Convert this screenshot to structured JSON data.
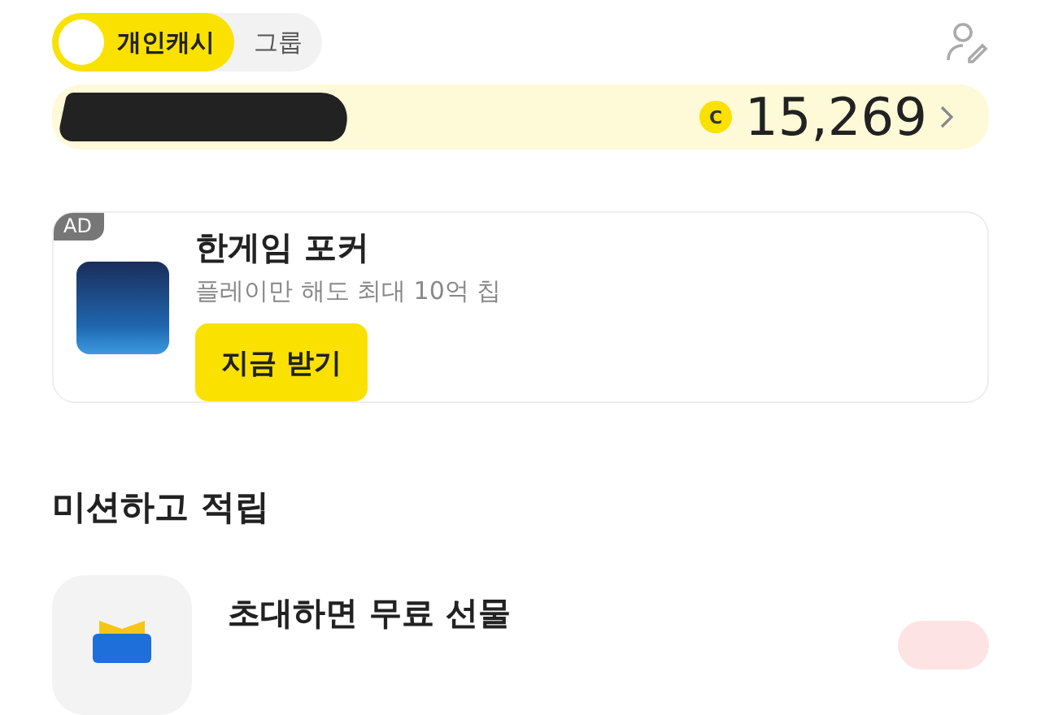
{
  "cash_toggle": [
    {
      "label": "개인캐시",
      "selected": true
    },
    {
      "label": "그룹",
      "selected": false
    }
  ],
  "balance_card": {
    "amount": "15,269",
    "coin_symbol": "C"
  },
  "ad_card": {
    "badge": "AD",
    "title": "한게임 포커",
    "subtitle": "플레이만 해도 최대 10억 칩",
    "button": "지금 받기"
  },
  "missions": {
    "heading": "미션하고 적립",
    "items": [
      {
        "title": "초대하면 무료 선물"
      }
    ]
  }
}
